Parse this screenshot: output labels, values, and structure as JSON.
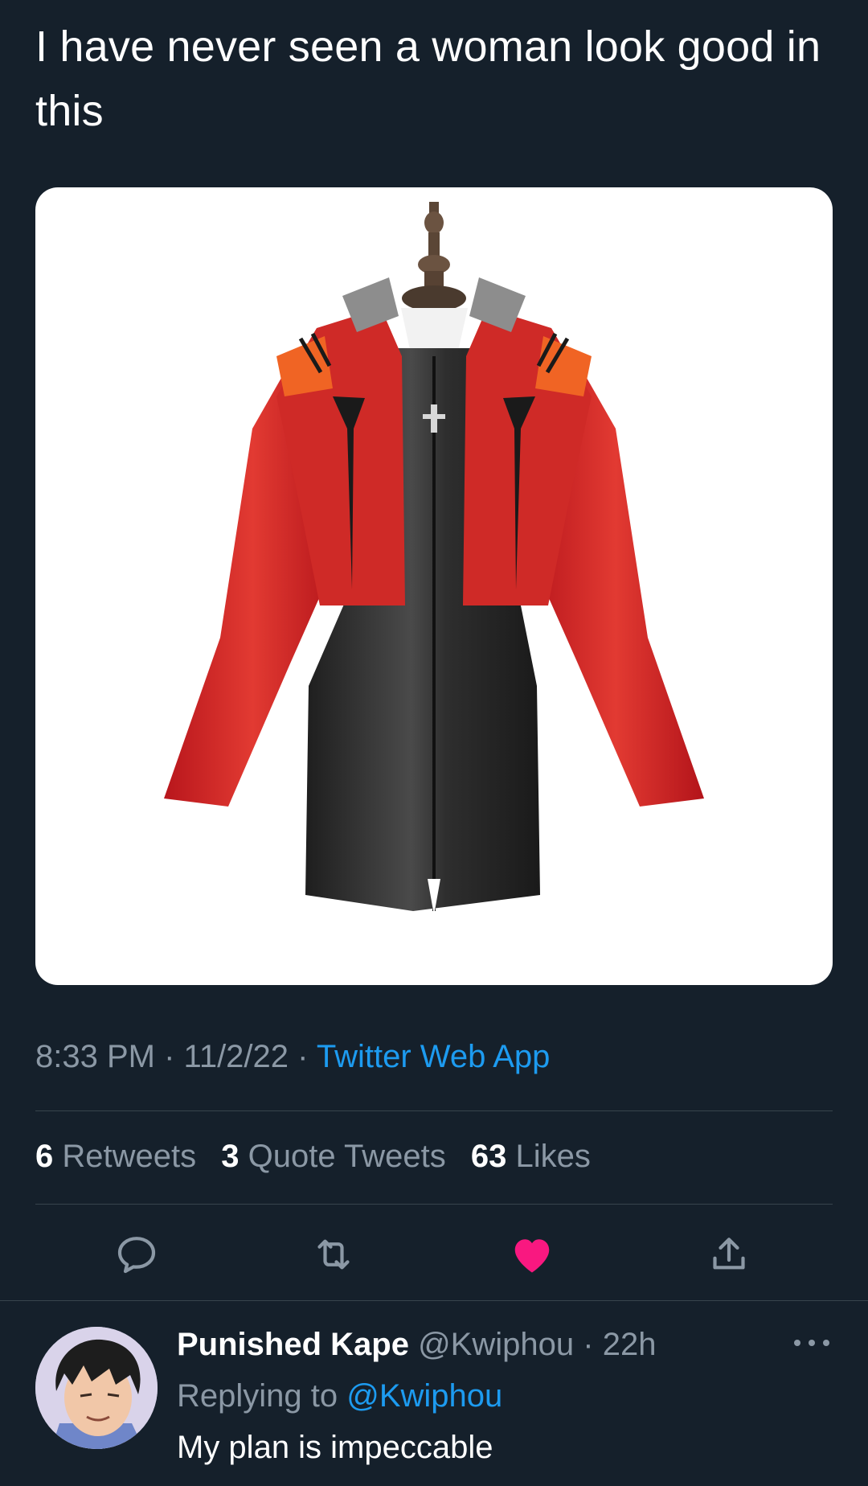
{
  "tweet": {
    "text": "I have never seen a woman look good in this",
    "time": "8:33 PM",
    "date": "11/2/22",
    "separator": "·",
    "source": "Twitter Web App"
  },
  "stats": {
    "retweets_count": "6",
    "retweets_label": "Retweets",
    "quotes_count": "3",
    "quotes_label": "Quote Tweets",
    "likes_count": "63",
    "likes_label": "Likes"
  },
  "actions": {
    "reply_icon": "reply-icon",
    "retweet_icon": "retweet-icon",
    "like_icon": "heart-icon",
    "share_icon": "share-icon",
    "like_color": "#f91880"
  },
  "reply": {
    "display_name": "Punished Kape",
    "handle": "@Kwiphou",
    "separator": "·",
    "age": "22h",
    "replying_prefix": "Replying to",
    "replying_to": "@Kwiphou",
    "text": "My plan is impeccable"
  },
  "colors": {
    "background": "#15202b",
    "muted": "#8b98a5",
    "accent": "#1d9bf0",
    "divider": "#38444d"
  }
}
